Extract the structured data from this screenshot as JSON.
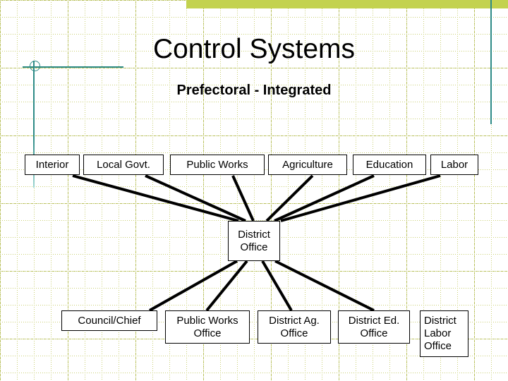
{
  "slide": {
    "title": "Control Systems",
    "subtitle": "Prefectoral - Integrated",
    "accent_color": "#c3d24f",
    "rule_color": "#2e8b87",
    "grid_color": "#b9bf4a"
  },
  "diagram": {
    "ministries": [
      {
        "id": "interior",
        "label": "Interior"
      },
      {
        "id": "local-govt",
        "label": "Local Govt."
      },
      {
        "id": "public-works",
        "label": "Public Works"
      },
      {
        "id": "agriculture",
        "label": "Agriculture"
      },
      {
        "id": "education",
        "label": "Education"
      },
      {
        "id": "labor",
        "label": "Labor"
      }
    ],
    "hub": {
      "id": "district-office",
      "line1": "District",
      "line2": "Office"
    },
    "field_units": [
      {
        "id": "council-chief",
        "line1": "Council/Chief",
        "line2": "",
        "line3": ""
      },
      {
        "id": "public-works-office",
        "line1": "Public Works",
        "line2": "Office",
        "line3": ""
      },
      {
        "id": "district-ag-office",
        "line1": "District Ag.",
        "line2": "Office",
        "line3": ""
      },
      {
        "id": "district-ed-office",
        "line1": "District Ed.",
        "line2": "Office",
        "line3": ""
      },
      {
        "id": "district-labor-office",
        "line1": "District",
        "line2": "Labor",
        "line3": "Office"
      }
    ]
  }
}
